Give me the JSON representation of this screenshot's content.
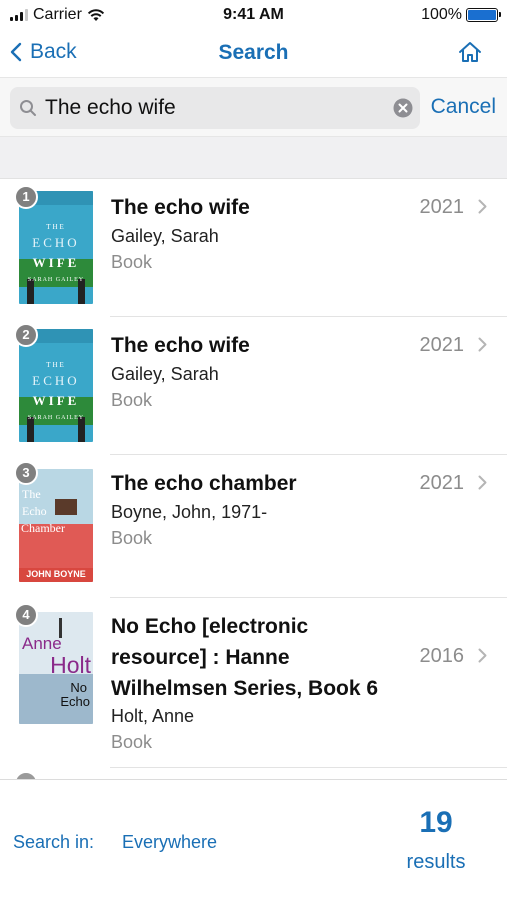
{
  "status_bar": {
    "carrier": "Carrier",
    "time": "9:41 AM",
    "battery": "100%",
    "battery_level": 1.0
  },
  "nav": {
    "back_label": "Back",
    "title": "Search",
    "home_icon": "home-icon"
  },
  "search": {
    "value": "The echo wife",
    "cancel_label": "Cancel"
  },
  "results": [
    {
      "number": "1",
      "title": "The echo wife",
      "author": "Gailey, Sarah",
      "format": "Book",
      "year": "2021",
      "cover": {
        "line1": "THE",
        "line2": "ECHO",
        "line3": "WIFE",
        "author": "SARAH GAILEY"
      }
    },
    {
      "number": "2",
      "title": "The echo wife",
      "author": "Gailey, Sarah",
      "format": "Book",
      "year": "2021",
      "cover": {
        "line1": "THE",
        "line2": "ECHO",
        "line3": "WIFE",
        "author": "SARAH GAILEY"
      }
    },
    {
      "number": "3",
      "title": "The echo chamber",
      "author": "Boyne, John, 1971-",
      "format": "Book",
      "year": "2021",
      "cover": {
        "line1": "The",
        "line2": "Echo",
        "line3": "Chamber",
        "author": "JOHN BOYNE"
      }
    },
    {
      "number": "4",
      "title": "No Echo [electronic resource] : Hanne Wilhelmsen Series, Book 6",
      "author": "Holt, Anne",
      "format": "Book",
      "year": "2016",
      "cover": {
        "line1": "Anne",
        "line2": "Holt",
        "line3": "No",
        "line4": "Echo"
      }
    }
  ],
  "bottom": {
    "search_in_label": "Search in:",
    "search_in_value": "Everywhere",
    "count": "19",
    "count_label": "results"
  },
  "colors": {
    "accent": "#1a6fb5",
    "muted": "#8c8c8c"
  }
}
